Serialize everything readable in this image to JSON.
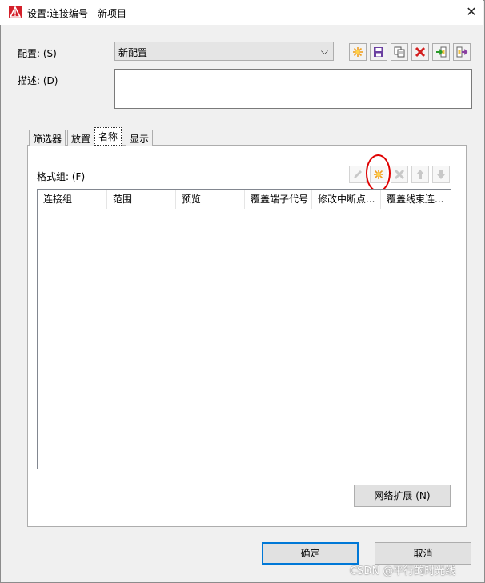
{
  "window": {
    "title": "设置:连接编号 - 新项目",
    "close_glyph": "✕"
  },
  "config": {
    "label": "配置: (S)",
    "value": "新配置",
    "dropdown_glyph": "⌵",
    "toolbar_icons": [
      "new-icon",
      "save-icon",
      "copy-icon",
      "delete-icon",
      "import-icon",
      "export-icon"
    ]
  },
  "description": {
    "label": "描述: (D)",
    "value": ""
  },
  "tabs": [
    {
      "label": "筛选器",
      "active": false
    },
    {
      "label": "放置",
      "active": false
    },
    {
      "label": "名称",
      "active": true
    },
    {
      "label": "显示",
      "active": false
    }
  ],
  "format_group": {
    "label": "格式组: (F)",
    "buttons": [
      "edit-icon",
      "new-icon",
      "delete-icon",
      "move-up-icon",
      "move-down-icon"
    ]
  },
  "table": {
    "columns": [
      "连接组",
      "范围",
      "预览",
      "覆盖端子代号",
      "修改中断点...",
      "覆盖线束连..."
    ],
    "rows": []
  },
  "network_button": "网络扩展 (N)",
  "ok_button": "确定",
  "cancel_button": "取消",
  "watermark": "CSDN @平行的时光线",
  "colors": {
    "highlight_circle": "#e00000",
    "primary_border": "#0078d7",
    "new_icon": "#f0a020",
    "delete_icon": "#d42020"
  }
}
